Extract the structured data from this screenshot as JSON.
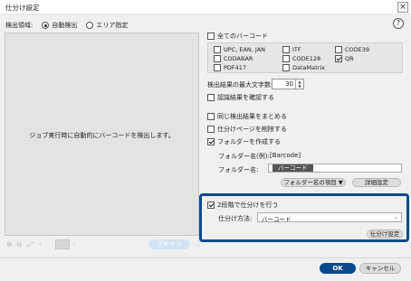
{
  "window": {
    "title": "仕分け設定",
    "close_glyph": "×"
  },
  "detect": {
    "label": "検出領域:",
    "auto_label": "自動検出",
    "area_label": "エリア指定",
    "selected": "auto"
  },
  "help_glyph": "?",
  "preview": {
    "message": "ジョブ実行時に自動的にバーコードを検出します。"
  },
  "preview_tools": {
    "scan_label": "スキャン"
  },
  "barcodes": {
    "all_label": "全てのバーコード",
    "all_checked": false,
    "items": [
      {
        "label": "UPC, EAN, JAN",
        "checked": false
      },
      {
        "label": "ITF",
        "checked": false
      },
      {
        "label": "CODE39",
        "checked": false
      },
      {
        "label": "CODABAR",
        "checked": false
      },
      {
        "label": "CODE128",
        "checked": false
      },
      {
        "label": "QR",
        "checked": true
      },
      {
        "label": "PDF417",
        "checked": false
      },
      {
        "label": "DataMatrix",
        "checked": false
      }
    ]
  },
  "max_chars": {
    "label": "検出結果の最大文字数:",
    "value": "30"
  },
  "confirm_result": {
    "label": "認識結果を確認する",
    "checked": false
  },
  "merge_same": {
    "label": "同じ検出結果をまとめる",
    "checked": false
  },
  "delete_sep": {
    "label": "仕分けページを削除する",
    "checked": false
  },
  "create_folder": {
    "label": "フォルダーを作成する",
    "checked": true
  },
  "folder": {
    "example_label": "フォルダー名(例):",
    "example_value": "[Barcode]",
    "name_label": "フォルダー名:",
    "name_tag": "バーコード",
    "items_button": "フォルダー名の項目 ▼",
    "detail_button": "詳細設定"
  },
  "second_level": {
    "label": "2段階で仕分けを行う",
    "checked": true,
    "method_label": "仕分け方法:",
    "method_value": "バーコード",
    "settings_button": "仕分け設定"
  },
  "footer": {
    "ok": "OK",
    "cancel": "キャンセル"
  },
  "colors": {
    "accent": "#0a4a8a",
    "panel": "#f0f0f0"
  }
}
